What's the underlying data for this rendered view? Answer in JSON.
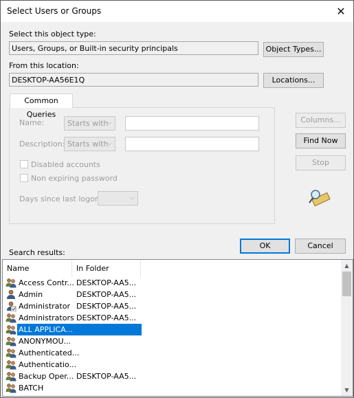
{
  "window": {
    "title": "Select Users or Groups"
  },
  "object_type": {
    "label": "Select this object type:",
    "value": "Users, Groups, or Built-in security principals",
    "button": "Object Types..."
  },
  "location": {
    "label": "From this location:",
    "value": "DESKTOP-AA56E1Q",
    "button": "Locations..."
  },
  "queries": {
    "tab": "Common Queries",
    "name_label": "Name:",
    "name_mode": "Starts with",
    "desc_label": "Description:",
    "desc_mode": "Starts with",
    "disabled_label": "Disabled accounts",
    "nonexp_label": "Non expiring password",
    "days_label": "Days since last logon:"
  },
  "side_buttons": {
    "columns": "Columns...",
    "find_now": "Find Now",
    "stop": "Stop"
  },
  "dialog_buttons": {
    "ok": "OK",
    "cancel": "Cancel"
  },
  "results": {
    "label": "Search results:",
    "columns": [
      "Name",
      "In Folder"
    ],
    "rows": [
      {
        "name": "Access Contr...",
        "folder": "DESKTOP-AA5...",
        "icon": "group-icon"
      },
      {
        "name": "Admin",
        "folder": "DESKTOP-AA5...",
        "icon": "user-icon"
      },
      {
        "name": "Administrator",
        "folder": "DESKTOP-AA5...",
        "icon": "admin-user-icon"
      },
      {
        "name": "Administrators",
        "folder": "DESKTOP-AA5...",
        "icon": "group-icon"
      },
      {
        "name": "ALL APPLICA...",
        "folder": "",
        "icon": "group-icon",
        "selected": true
      },
      {
        "name": "ANONYMOU...",
        "folder": "",
        "icon": "group-icon"
      },
      {
        "name": "Authenticated...",
        "folder": "",
        "icon": "group-icon"
      },
      {
        "name": "Authenticatio...",
        "folder": "",
        "icon": "group-icon"
      },
      {
        "name": "Backup Oper...",
        "folder": "DESKTOP-AA5...",
        "icon": "group-icon"
      },
      {
        "name": "BATCH",
        "folder": "",
        "icon": "group-icon"
      }
    ]
  },
  "colors": {
    "accent": "#0078d7",
    "disabled_text": "#9c9c9c"
  }
}
